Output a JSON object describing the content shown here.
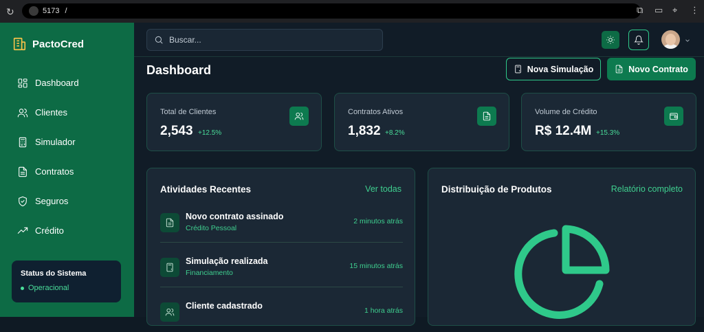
{
  "browser": {
    "url_port": "5173",
    "url_path": "/"
  },
  "sidebar": {
    "brand": "PactoCred",
    "items": [
      {
        "label": "Dashboard",
        "icon": "grid-icon"
      },
      {
        "label": "Clientes",
        "icon": "users-icon"
      },
      {
        "label": "Simulador",
        "icon": "calculator-icon"
      },
      {
        "label": "Contratos",
        "icon": "document-icon"
      },
      {
        "label": "Seguros",
        "icon": "shield-icon"
      },
      {
        "label": "Crédito",
        "icon": "trending-up-icon"
      }
    ],
    "status": {
      "title": "Status do Sistema",
      "state": "Operacional"
    }
  },
  "topbar": {
    "search_placeholder": "Buscar..."
  },
  "main": {
    "title": "Dashboard",
    "btn_simulacao": "Nova Simulação",
    "btn_contrato": "Novo Contrato",
    "stats": [
      {
        "label": "Total de Clientes",
        "value": "2,543",
        "delta": "+12.5%"
      },
      {
        "label": "Contratos Ativos",
        "value": "1,832",
        "delta": "+8.2%"
      },
      {
        "label": "Volume de Crédito",
        "value": "R$ 12.4M",
        "delta": "+15.3%"
      }
    ],
    "activities": {
      "title": "Atividades Recentes",
      "link": "Ver todas",
      "items": [
        {
          "title": "Novo contrato assinado",
          "subtitle": "Crédito Pessoal",
          "time": "2 minutos atrás"
        },
        {
          "title": "Simulação realizada",
          "subtitle": "Financiamento",
          "time": "15 minutos atrás"
        },
        {
          "title": "Cliente cadastrado",
          "subtitle": "",
          "time": "1 hora atrás"
        }
      ]
    },
    "products": {
      "title": "Distribuição de Produtos",
      "link": "Relatório completo"
    }
  },
  "colors": {
    "accent": "#0d7a4f",
    "sidebar": "#0d6b45",
    "highlight": "#3fcf8f",
    "background": "#111c27"
  }
}
